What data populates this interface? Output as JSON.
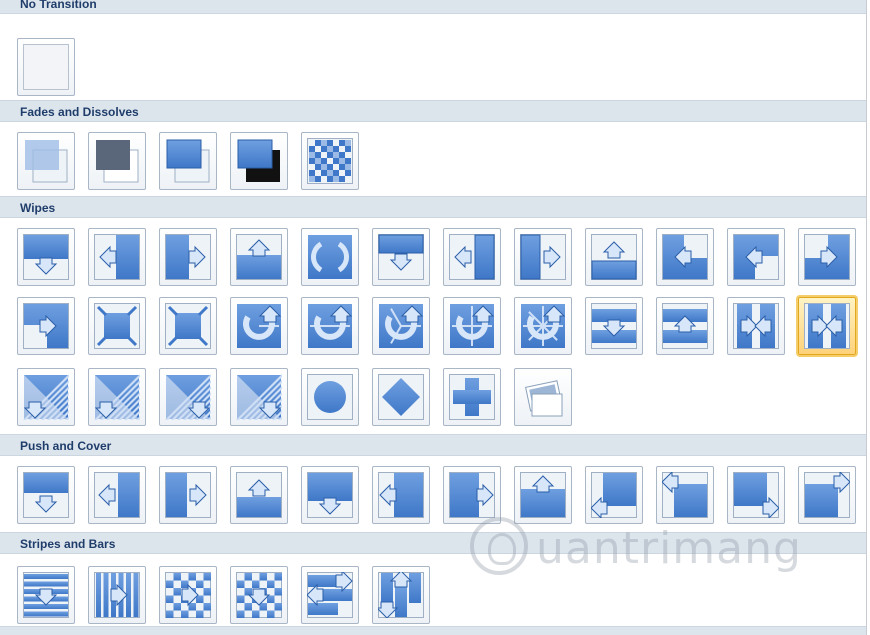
{
  "colors": {
    "header_bg": "#dde5ec",
    "header_text": "#1f3d6b",
    "thumb_blue": "#3f78c8",
    "selected_border": "#e2a81d"
  },
  "sections": [
    {
      "title": "No Transition",
      "rows": [
        [
          "none"
        ]
      ]
    },
    {
      "title": "Fades and Dissolves",
      "rows": [
        [
          "fade-smooth",
          "fade-black",
          "cut",
          "cut-black",
          "dissolve"
        ]
      ]
    },
    {
      "title": "Wipes",
      "rows": [
        [
          "wipe-down",
          "wipe-left",
          "wipe-right",
          "wipe-up",
          "wheel-clockwise",
          "uncover-down",
          "uncover-left",
          "uncover-right",
          "uncover-up",
          "uncover-left-down",
          "uncover-left-up",
          "uncover-right-down"
        ],
        [
          "uncover-right-up",
          "box-in",
          "box-out",
          "wheel-1",
          "wheel-2",
          "wheel-3",
          "wheel-4",
          "wheel-8",
          "split-horizontal-in",
          "split-horizontal-out",
          "split-vertical-in",
          "split-vertical-out"
        ],
        [
          "strips-left-down",
          "strips-left-up",
          "strips-right-down",
          "strips-right-up",
          "circle",
          "diamond",
          "plus",
          "newsflash"
        ]
      ]
    },
    {
      "title": "Push and Cover",
      "rows": [
        [
          "push-down",
          "push-left",
          "push-right",
          "push-up",
          "cover-down",
          "cover-left",
          "cover-right",
          "cover-up",
          "cover-left-down",
          "cover-left-up",
          "cover-right-down",
          "cover-right-up"
        ]
      ]
    },
    {
      "title": "Stripes and Bars",
      "rows": [
        [
          "blinds-horizontal",
          "blinds-vertical",
          "checkerboard-across",
          "checkerboard-down",
          "comb-horizontal",
          "comb-vertical"
        ]
      ]
    },
    {
      "title": "",
      "rows": []
    }
  ],
  "selected": "split-vertical-out",
  "watermark": {
    "text": "uantrimang"
  }
}
